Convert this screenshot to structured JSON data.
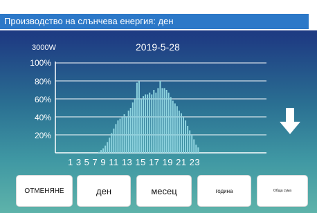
{
  "title": "Производство на слънчева енергия: ден",
  "chart": {
    "max_label": "3000W",
    "date": "2019-5-28",
    "y_labels": [
      "100%",
      "80%",
      "60%",
      "40%",
      "20%"
    ],
    "x_labels": "1 3 5 7 9 11 13 15 17 19 21 23",
    "down_icon": "arrow-down-icon",
    "bar_color": "#8fd4e0"
  },
  "chart_data": {
    "type": "bar",
    "title": "2019-5-28",
    "ylabel": "",
    "xlabel": "",
    "ylim": [
      0,
      100
    ],
    "x_ticks": [
      1,
      3,
      5,
      7,
      9,
      11,
      13,
      15,
      17,
      19,
      21,
      23
    ],
    "y_ticks": [
      "20%",
      "40%",
      "60%",
      "80%",
      "100%"
    ],
    "values": [
      1,
      3,
      5,
      8,
      12,
      17,
      22,
      27,
      32,
      36,
      38,
      40,
      43,
      40,
      47,
      50,
      56,
      60,
      78,
      80,
      60,
      63,
      65,
      65,
      67,
      65,
      70,
      67,
      72,
      80,
      72,
      72,
      70,
      67,
      62,
      58,
      55,
      52,
      47,
      44,
      40,
      36,
      30,
      25,
      20,
      15,
      9,
      6
    ]
  },
  "buttons": [
    {
      "label": "ОТМЕНЯНЕ"
    },
    {
      "label": "ден"
    },
    {
      "label": "месец"
    },
    {
      "label": "година"
    },
    {
      "label": "Обща сума"
    }
  ]
}
